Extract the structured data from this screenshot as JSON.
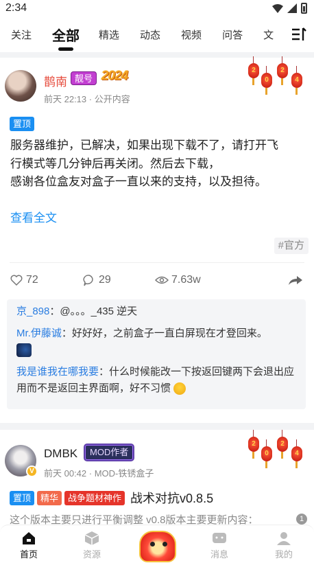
{
  "status": {
    "time": "2:34"
  },
  "tabs": [
    "关注",
    "全部",
    "精选",
    "动态",
    "视频",
    "问答",
    "文"
  ],
  "active_tab": "全部",
  "post1": {
    "author": "鹊南",
    "badge": "靓号",
    "deco": "2024",
    "time": "前天 22:13",
    "visibility": "公开内容",
    "pin": "置顶",
    "body_lines": [
      "服务器维护，已解决，如果出现下载不了，请打开飞",
      "行模式等几分钟后再关闭。然后去下载，",
      "感谢各位盒友对盒子一直以来的支持，以及担待。"
    ],
    "read_more": "查看全文",
    "topic": "#官方",
    "likes": "72",
    "comments_count": "29",
    "views": "7.63w",
    "lanterns": [
      "2",
      "0",
      "2",
      "4"
    ],
    "comments": [
      {
        "user": "京_898",
        "text": "：@。。。_435 逆天"
      },
      {
        "user": "Mr.伊藤诚",
        "text": "：好好好，之前盒子一直白屏现在才登回来。"
      },
      {
        "user": "我是谁我在哪我要",
        "text": "：什么时候能改一下按返回键两下会退出应用而不是返回主界面啊，好不习惯"
      }
    ]
  },
  "post2": {
    "author": "DMBK",
    "badge": "MOD作者",
    "time": "前天 00:42",
    "source": "MOD-铁锈盒子",
    "tags": [
      "置顶",
      "精华",
      "战争题材神作"
    ],
    "title": "战术对抗v0.8.5",
    "preview": "这个版本主要只进行平衡调整 v0.8版本主要更新内容：",
    "info": "1",
    "lanterns": [
      "2",
      "0",
      "2",
      "4"
    ]
  },
  "bottom_nav": [
    "首页",
    "资源",
    "消息",
    "我的"
  ]
}
